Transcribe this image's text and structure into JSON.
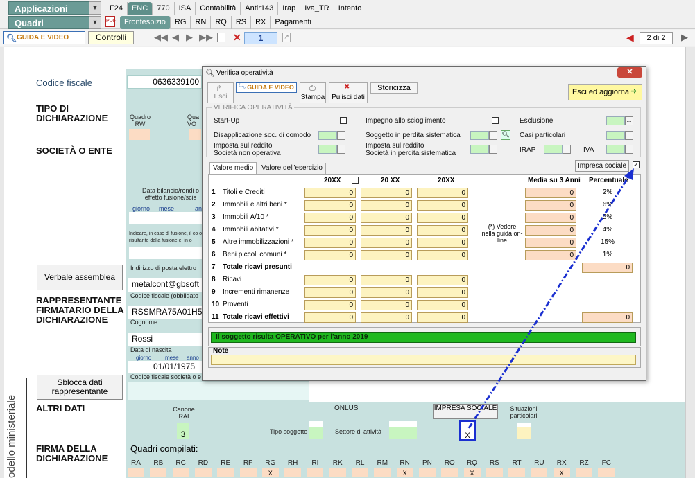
{
  "topbar": {
    "applicazioni": "Applicazioni",
    "quadri": "Quadri",
    "tabs": [
      "F24",
      "ENC",
      "770",
      "ISA",
      "Contabilità",
      "Antir143",
      "Irap",
      "Iva_TR",
      "Intento"
    ],
    "subtabs": [
      "Frontespizio",
      "RG",
      "RN",
      "RQ",
      "RS",
      "RX",
      "Pagamenti"
    ]
  },
  "toolbar": {
    "guida": "GUIDA E VIDEO",
    "controlli": "Controlli",
    "page": "1",
    "page_of": "2 di 2"
  },
  "form": {
    "codice_fiscale_label": "Codice fiscale",
    "codice_fiscale_value": "0636339100",
    "tipo_dich": "TIPO DI DICHIARAZIONE",
    "quadro_rw": "Quadro RW",
    "quadro_vo": "Qua VO",
    "societa": "SOCIETÀ O ENTE",
    "data_bilancio": "Data bilancio/rendi o effetto fusione/scis",
    "giorno": "giorno",
    "mese": "mese",
    "anno": "an",
    "indicare": "Indicare, in caso di fusione, il co o risultante dalla fusione e, in o",
    "verbale": "Verbale assemblea",
    "indirizzo_label": "Indirizzo di posta elettro",
    "email": "metalcont@gbsoft",
    "rappresentante": "RAPPRESENTANTE FIRMATARIO DELLA DICHIARAZIONE",
    "cf_obbligato": "Codice fiscale (obbligato",
    "cf_value": "RSSMRA75A01H5",
    "cognome_label": "Cognome",
    "cognome": "Rossi",
    "nascita_label": "Data di nascita",
    "nascita_g": "giorno",
    "nascita_m": "mese",
    "nascita_a": "anno",
    "nascita": "01/01/1975",
    "cf_societa": "Codice fiscale società o e",
    "sblocca": "Sblocca dati rappresentante",
    "modello": "odello ministeriale",
    "altri_dati": "ALTRI DATI",
    "canone": "Canone RAI",
    "canone_val": "3",
    "onlus": "ONLUS",
    "tipo_soggetto": "Tipo soggetto",
    "settore": "Settore di attività",
    "impresa_btn": "IMPRESA SOCIALE",
    "impresa_val": "X",
    "situazioni": "Situazioni particolari",
    "firma": "FIRMA DELLA DICHIARAZIONE",
    "quadri_compilati": "Quadri compilati:",
    "quadri": [
      "RA",
      "RB",
      "RC",
      "RD",
      "RE",
      "RF",
      "RG",
      "RH",
      "RI",
      "RK",
      "RL",
      "RM",
      "RN",
      "PN",
      "RO",
      "RQ",
      "RS",
      "RT",
      "RU",
      "RX",
      "RZ",
      "FC"
    ],
    "quadri_checked": [
      "",
      "",
      "",
      "",
      "",
      "",
      "X",
      "",
      "",
      "",
      "",
      "",
      "X",
      "",
      "",
      "X",
      "",
      "",
      "",
      "X",
      "",
      ""
    ]
  },
  "dialog": {
    "title": "Verifica operatività",
    "esci": "Esci",
    "guida": "GUIDA E VIDEO",
    "stampa": "Stampa",
    "pulisci": "Pulisci dati",
    "storicizza": "Storicizza",
    "esci_agg": "Esci ed aggiorna",
    "group_title": "VERIFICA OPERATIVITÀ",
    "startup": "Start-Up",
    "impegno": "Impegno allo scioglimento",
    "esclusione": "Esclusione",
    "disapp": "Disapplicazione soc. di comodo",
    "soggetto_perdita": "Soggetto in perdita sistematica",
    "casi": "Casi particolari",
    "imposta1a": "Imposta sul reddito",
    "imposta1b": "Società non operativa",
    "imposta2a": "Imposta sul reddito",
    "imposta2b": "Società in perdita sistematica",
    "irap": "IRAP",
    "iva": "IVA",
    "tab1": "Valore medio",
    "tab2": "Valore dell'esercizio",
    "impresa_sociale": "Impresa sociale",
    "impresa_checked": "✓",
    "col1": "20XX",
    "col2": "20 XX",
    "col3": "20XX",
    "col_media": "Media su 3 Anni",
    "col_perc": "Percentuale",
    "vedere": "(*) Vedere nella guida on-line",
    "rows": [
      {
        "n": "1",
        "label": "Titoli e Crediti",
        "v1": "0",
        "v2": "0",
        "v3": "0",
        "m": "0",
        "p": "2%",
        "bold": false
      },
      {
        "n": "2",
        "label": "Immobili e altri beni *",
        "v1": "0",
        "v2": "0",
        "v3": "0",
        "m": "0",
        "p": "6%",
        "bold": false
      },
      {
        "n": "3",
        "label": "Immobili A/10 *",
        "v1": "0",
        "v2": "0",
        "v3": "0",
        "m": "0",
        "p": "5%",
        "bold": false
      },
      {
        "n": "4",
        "label": "Immobili abitativi *",
        "v1": "0",
        "v2": "0",
        "v3": "0",
        "m": "0",
        "p": "4%",
        "bold": false
      },
      {
        "n": "5",
        "label": "Altre immobilizzazioni *",
        "v1": "0",
        "v2": "0",
        "v3": "0",
        "m": "0",
        "p": "15%",
        "bold": false
      },
      {
        "n": "6",
        "label": "Beni piccoli comuni *",
        "v1": "0",
        "v2": "0",
        "v3": "0",
        "m": "0",
        "p": "1%",
        "bold": false
      },
      {
        "n": "7",
        "label": "Totale ricavi presunti",
        "v1": "",
        "v2": "",
        "v3": "",
        "m": "",
        "p": "0",
        "bold": true
      },
      {
        "n": "8",
        "label": "Ricavi",
        "v1": "0",
        "v2": "0",
        "v3": "0",
        "m": "",
        "p": "",
        "bold": false
      },
      {
        "n": "9",
        "label": "Incrementi rimanenze",
        "v1": "0",
        "v2": "0",
        "v3": "0",
        "m": "",
        "p": "",
        "bold": false
      },
      {
        "n": "10",
        "label": "Proventi",
        "v1": "0",
        "v2": "0",
        "v3": "0",
        "m": "",
        "p": "",
        "bold": false
      },
      {
        "n": "11",
        "label": "Totale ricavi effettivi",
        "v1": "0",
        "v2": "0",
        "v3": "0",
        "m": "",
        "p": "0",
        "bold": true
      }
    ],
    "status": "Il soggetto risulta OPERATIVO per l'anno 2019",
    "note": "Note"
  },
  "colors": {
    "teal": "#6b9b96",
    "green": "#1fb81f",
    "arrow": "#1a2fd0"
  }
}
